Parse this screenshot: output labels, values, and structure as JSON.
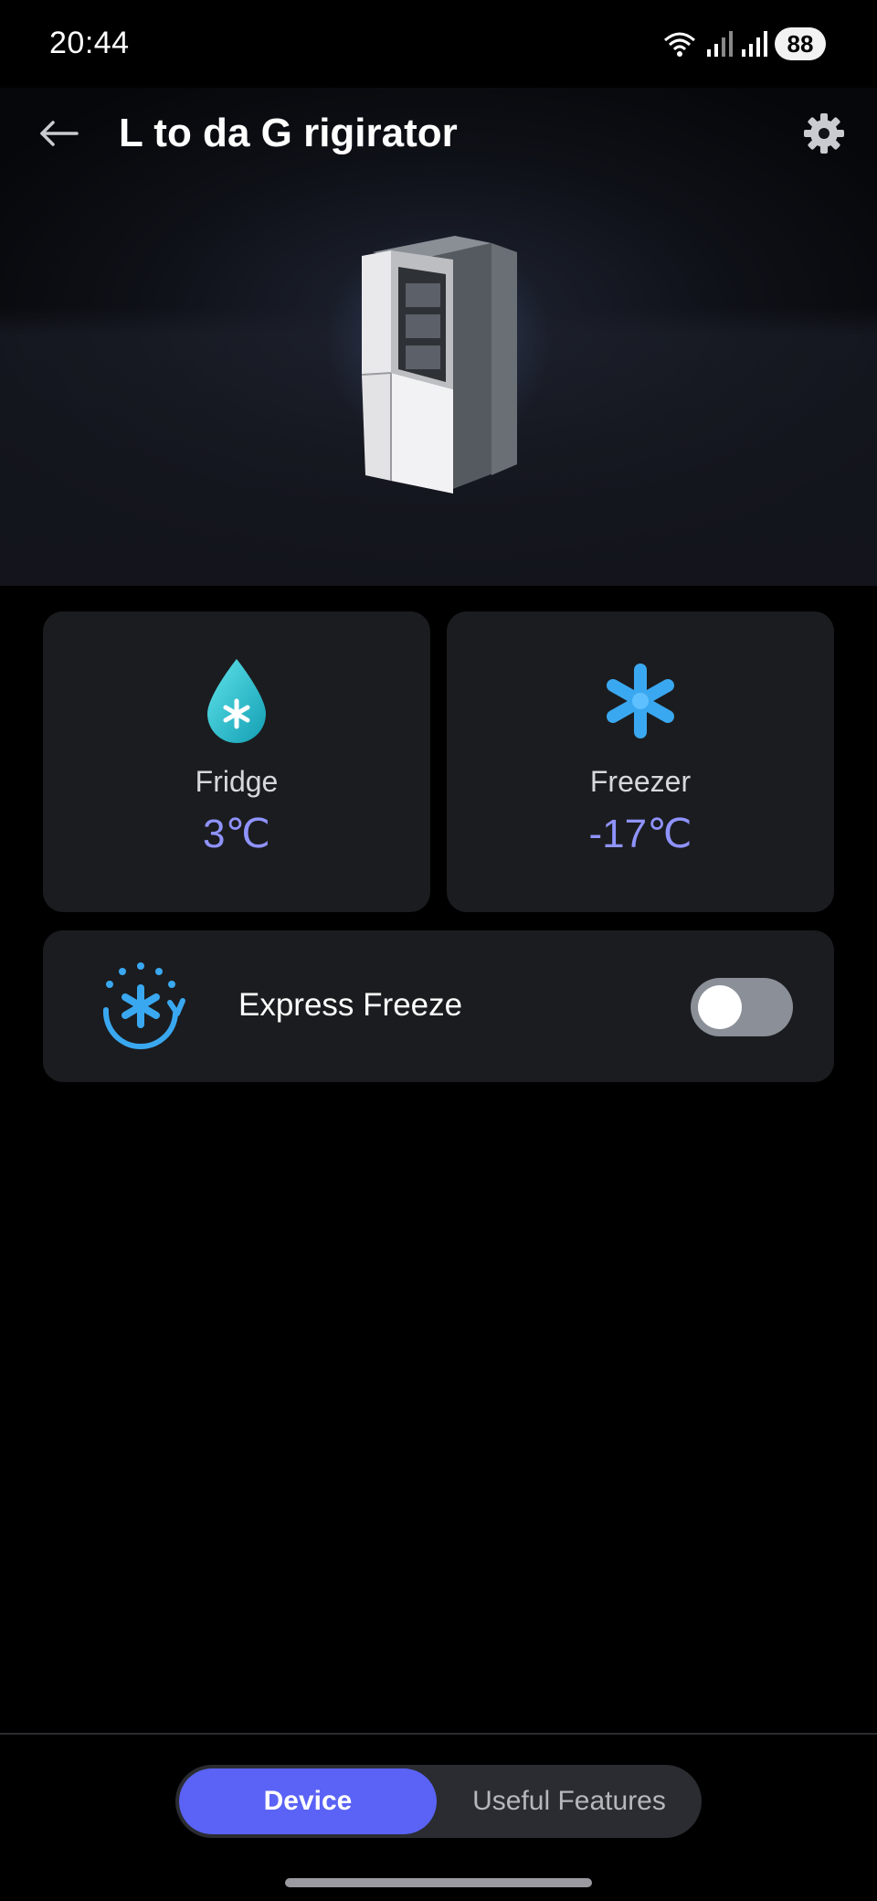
{
  "status_bar": {
    "time": "20:44",
    "battery": "88",
    "icons": [
      "wifi-icon",
      "signal-icon",
      "signal-icon",
      "battery-icon"
    ]
  },
  "header": {
    "title": "L to da G rigirator",
    "back_icon": "arrow-left-icon",
    "settings_icon": "gear-icon"
  },
  "cards": {
    "fridge": {
      "label": "Fridge",
      "value": "3℃",
      "icon": "water-drop-snowflake-icon"
    },
    "freezer": {
      "label": "Freezer",
      "value": "-17℃",
      "icon": "snowflake-icon"
    }
  },
  "express_freeze": {
    "label": "Express Freeze",
    "icon": "express-freeze-icon",
    "enabled": false
  },
  "bottom_nav": {
    "device_label": "Device",
    "features_label": "Useful Features",
    "active": "Device"
  },
  "colors": {
    "accent": "#5a63f5",
    "temperature": "#8f93ff",
    "card_bg": "#1b1c1f",
    "icon_blue": "#3aa8f0",
    "icon_teal": "#2cc4d4"
  }
}
